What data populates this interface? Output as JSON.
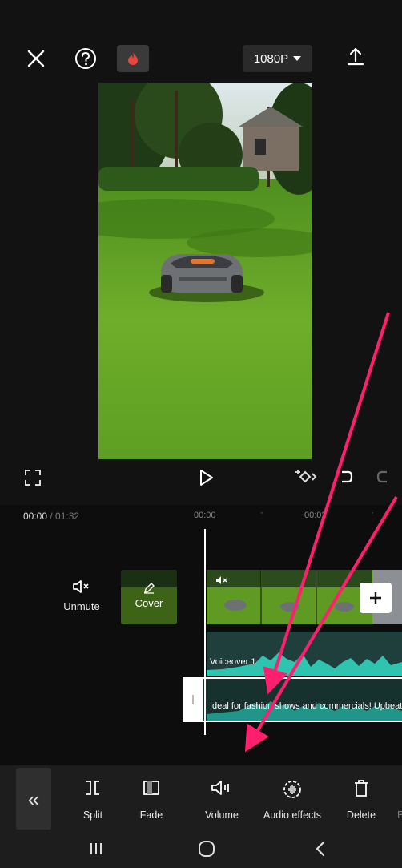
{
  "header": {
    "resolution_label": "1080P"
  },
  "timeline": {
    "current_time": "00:00",
    "separator": " / ",
    "total_time": "01:32",
    "ruler_ticks": [
      "00:00",
      "00:02"
    ],
    "unmute_label": "Unmute",
    "cover_label": "Cover",
    "voiceover_label": "Voiceover 1",
    "music_label": "Ideal for fashion shows and commercials! Upbeat"
  },
  "toolbar": {
    "items": [
      {
        "label": "Split",
        "icon": "split-icon"
      },
      {
        "label": "Fade",
        "icon": "fade-icon"
      },
      {
        "label": "Volume",
        "icon": "volume-icon"
      },
      {
        "label": "Audio effects",
        "icon": "audio-effects-icon"
      },
      {
        "label": "Delete",
        "icon": "delete-icon"
      },
      {
        "label": "B",
        "icon": "partial-icon"
      }
    ]
  },
  "colors": {
    "annotation_arrow": "#ff1f6e",
    "waveform": "#2ec4b0",
    "flame_badge": "#e8453c"
  }
}
